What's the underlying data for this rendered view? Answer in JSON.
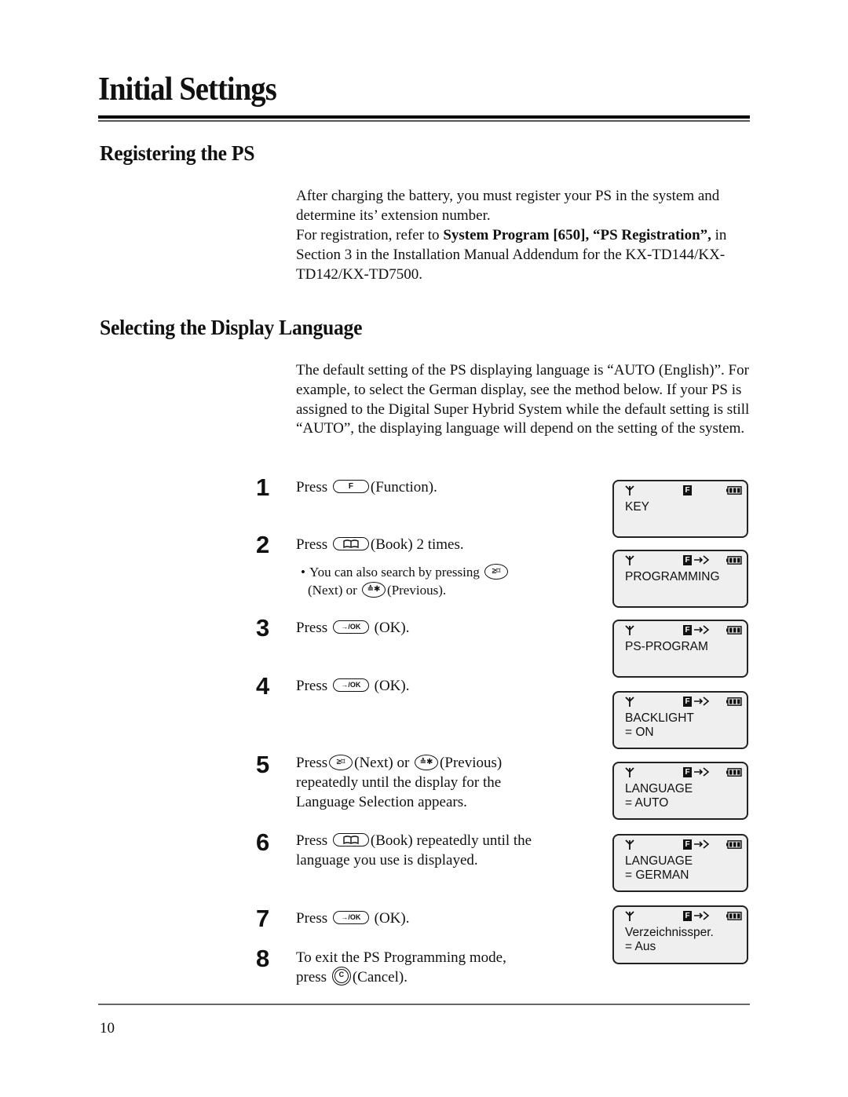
{
  "page": {
    "title": "Initial Settings",
    "page_number": "10"
  },
  "registering": {
    "heading": "Registering the PS",
    "p1": "After charging the battery, you must register your PS in the system and determine its’ extension number.",
    "p2_before": "For registration, refer to ",
    "p2_bold": "System Program [650], “PS Registration”,",
    "p2_after": " in Section 3 in the Installation Manual Addendum for the KX-TD144/KX-TD142/KX-TD7500."
  },
  "language": {
    "heading": "Selecting the Display Language",
    "intro": "The default setting of the PS displaying language is “AUTO (English)”.  For example, to select the German display, see the method below.  If your PS is assigned to the Digital Super Hybrid System while the default setting is still “AUTO”, the displaying language will depend on the setting of the system."
  },
  "keys": {
    "function": "F",
    "book": "🕮",
    "ok": "→/OK",
    "next": "≥⌑",
    "previous": "≙✱",
    "cancel": "C"
  },
  "steps": [
    {
      "number": "1",
      "press": "Press",
      "label": "(Function)."
    },
    {
      "number": "2",
      "press": "Press",
      "label": "(Book) 2 times.",
      "note_bullet": "•",
      "note_a": "You can also search by pressing",
      "note_b": "(Next) or",
      "note_c": "(Previous)."
    },
    {
      "number": "3",
      "press": "Press",
      "label": "(OK)."
    },
    {
      "number": "4",
      "press": "Press",
      "label": "(OK)."
    },
    {
      "number": "5",
      "press": "Press",
      "label_a": "(Next) or",
      "label_b": "(Previous) repeatedly until the display for the Language Selection appears."
    },
    {
      "number": "6",
      "press": "Press",
      "label": "(Book) repeatedly until the language you use is displayed."
    },
    {
      "number": "7",
      "press": "Press",
      "label": "(OK)."
    },
    {
      "number": "8",
      "text": "To exit the PS Programming mode,",
      "press": "press",
      "label": "(Cancel)."
    }
  ],
  "displays": [
    {
      "line1": "KEY",
      "line2": "",
      "f_indicator": "F",
      "arrow": false
    },
    {
      "line1": "PROGRAMMING",
      "line2": "",
      "f_indicator": "F",
      "arrow": true
    },
    {
      "line1": "PS-PROGRAM",
      "line2": "",
      "f_indicator": "F",
      "arrow": true
    },
    {
      "line1": "BACKLIGHT",
      "line2": "= ON",
      "f_indicator": "F",
      "arrow": true
    },
    {
      "line1": "LANGUAGE",
      "line2": "= AUTO",
      "f_indicator": "F",
      "arrow": true
    },
    {
      "line1": "LANGUAGE",
      "line2": "= GERMAN",
      "f_indicator": "F",
      "arrow": true
    },
    {
      "line1": "Verzeichnissper.",
      "line2": "= Aus",
      "f_indicator": "F",
      "arrow": true
    }
  ]
}
